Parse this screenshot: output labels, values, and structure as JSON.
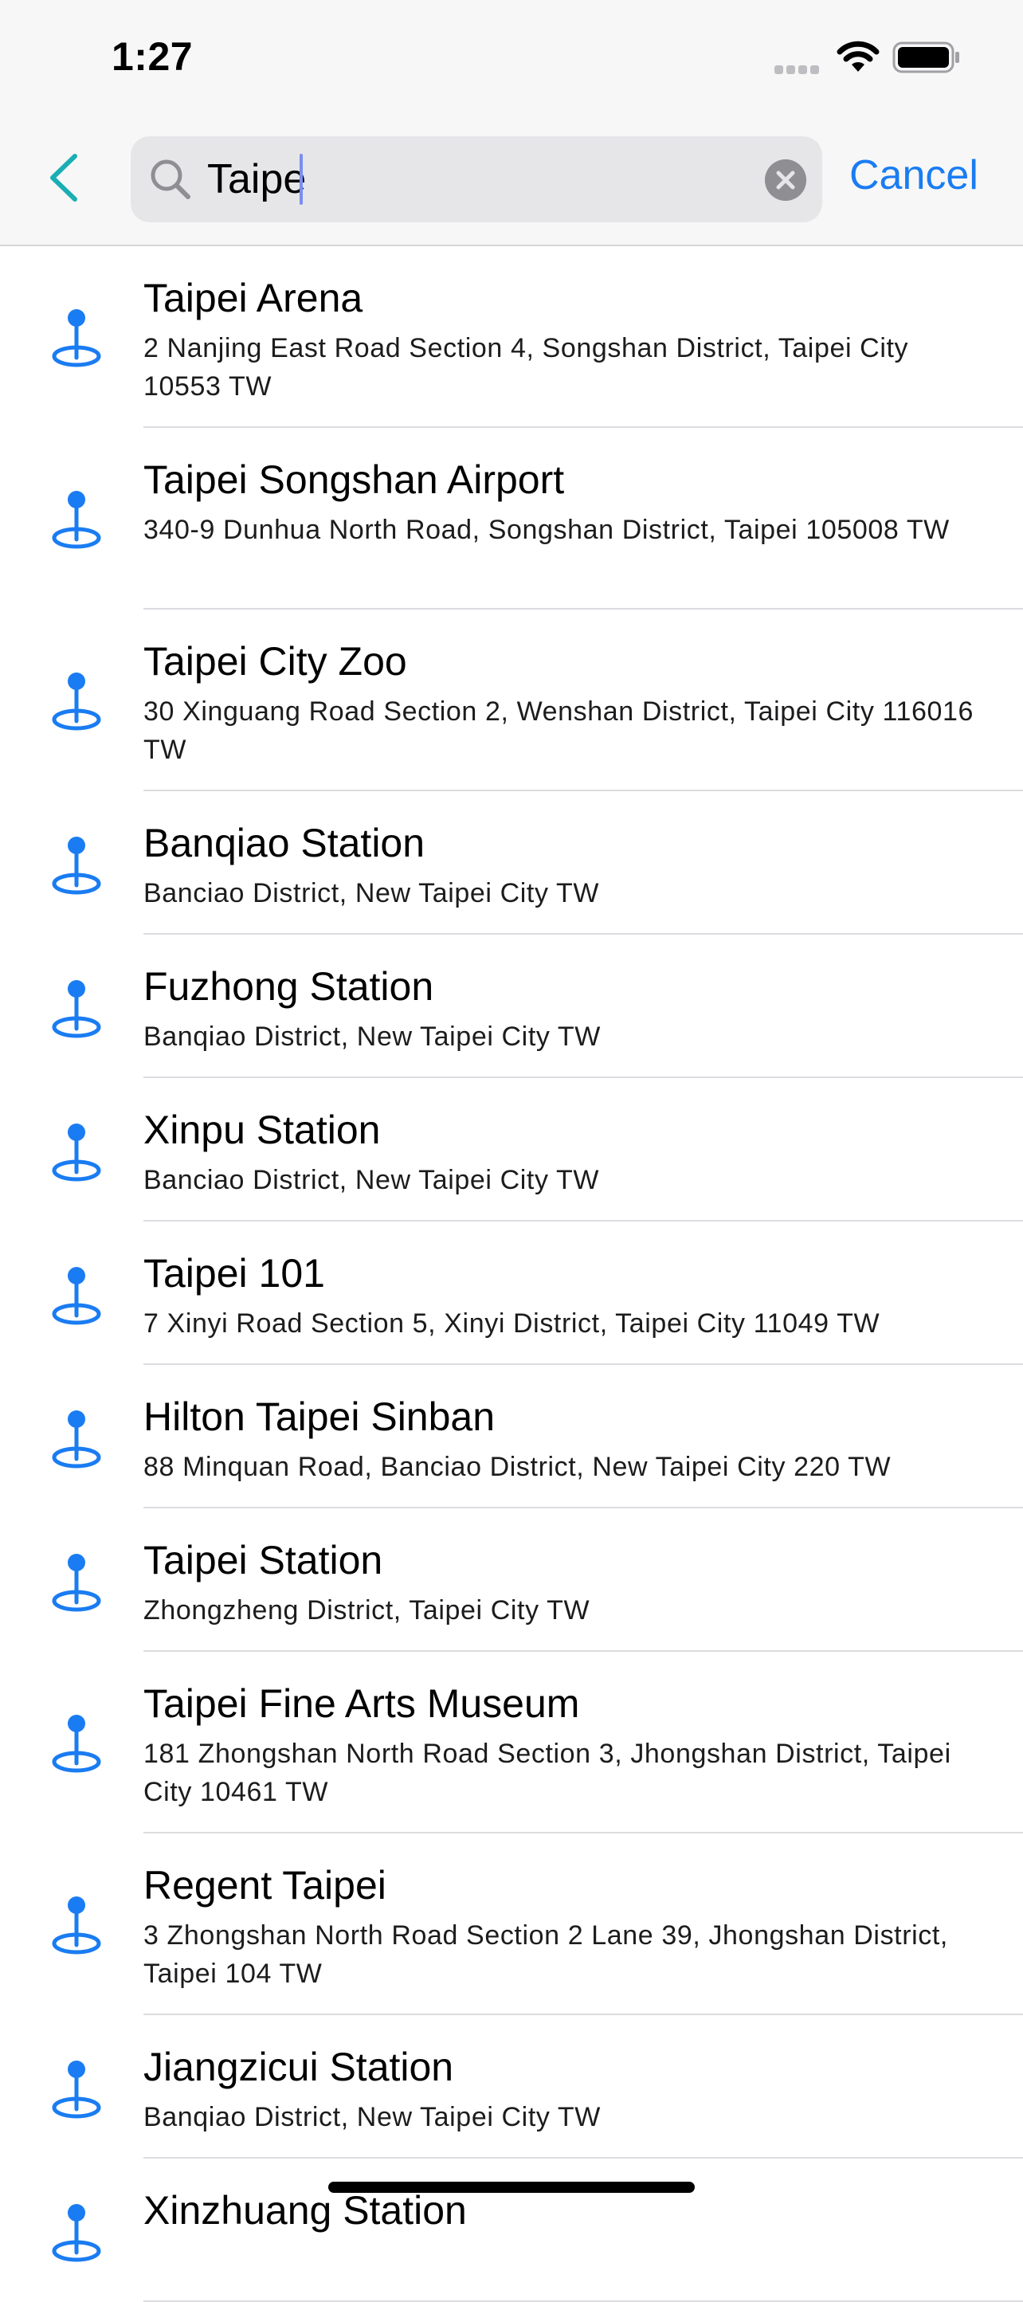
{
  "status_bar": {
    "time": "1:27"
  },
  "search": {
    "query": "Taipe",
    "cancel_label": "Cancel"
  },
  "colors": {
    "accent": "#1a7cf2",
    "back_arrow": "#1aaeb4",
    "pin": "#1a7cf2",
    "separator": "#dcdce0"
  },
  "icons": {
    "back": "chevron-left-icon",
    "search": "magnifying-glass-icon",
    "clear": "xmark-circle-icon",
    "result": "map-pin-icon"
  },
  "results": [
    {
      "title": "Taipei Arena",
      "address": "2 Nanjing East Road Section 4, Songshan District, Taipei City 10553 TW"
    },
    {
      "title": "Taipei Songshan Airport",
      "address": "340-9 Dunhua North Road, Songshan District, Taipei 105008 TW"
    },
    {
      "title": "Taipei City Zoo",
      "address": "30 Xinguang Road Section 2, Wenshan District, Taipei City 116016 TW"
    },
    {
      "title": "Banqiao Station",
      "address": "Banciao District, New Taipei City TW"
    },
    {
      "title": "Fuzhong Station",
      "address": "Banqiao District, New Taipei City TW"
    },
    {
      "title": "Xinpu Station",
      "address": "Banciao District, New Taipei City TW"
    },
    {
      "title": "Taipei 101",
      "address": "7 Xinyi Road Section 5, Xinyi District, Taipei City 11049 TW"
    },
    {
      "title": "Hilton Taipei Sinban",
      "address": "88 Minquan Road, Banciao District, New Taipei City 220 TW"
    },
    {
      "title": "Taipei Station",
      "address": "Zhongzheng District, Taipei City TW"
    },
    {
      "title": "Taipei Fine Arts Museum",
      "address": "181 Zhongshan North Road Section 3, Jhongshan District, Taipei City 10461 TW"
    },
    {
      "title": "Regent Taipei",
      "address": "3 Zhongshan North Road Section 2 Lane 39, Jhongshan District, Taipei 104 TW"
    },
    {
      "title": "Jiangzicui Station",
      "address": "Banqiao District, New Taipei City TW"
    },
    {
      "title": "Xinzhuang Station",
      "address": ""
    }
  ]
}
